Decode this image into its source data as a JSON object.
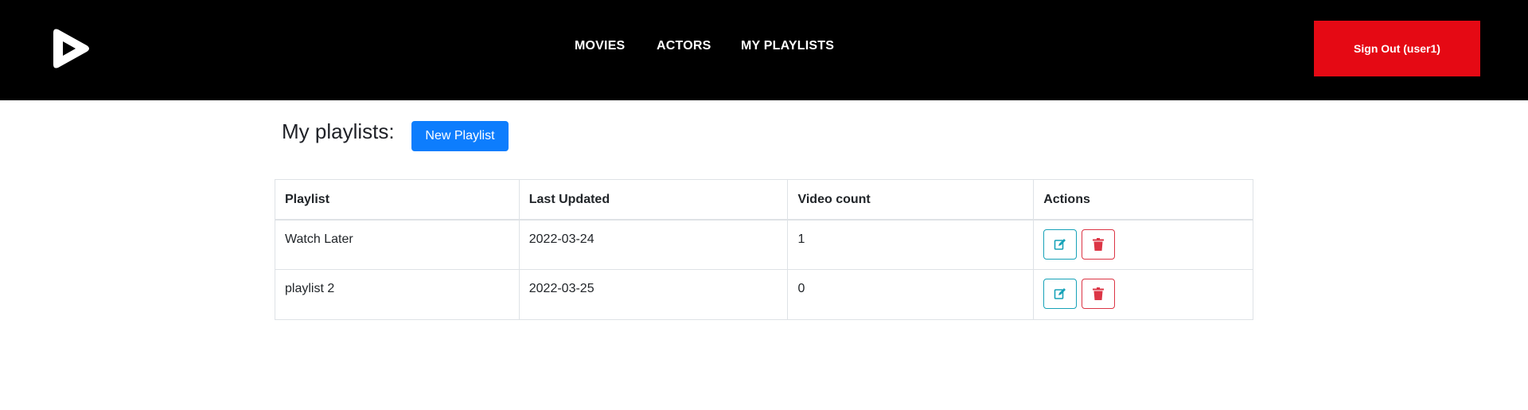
{
  "navbar": {
    "logo_icon": "play-logo-icon",
    "links": {
      "movies": "MOVIES",
      "actors": "ACTORS",
      "playlists": "MY PLAYLISTS"
    },
    "sign_out": "Sign Out (user1)",
    "colors": {
      "background": "#000000",
      "sign_out": "#e50914"
    }
  },
  "main": {
    "heading": "My playlists:",
    "new_button": "New Playlist",
    "table": {
      "headers": [
        "Playlist",
        "Last Updated",
        "Video count",
        "Actions"
      ],
      "rows": [
        {
          "name": "Watch Later",
          "updated": "2022-03-24",
          "count": "1"
        },
        {
          "name": "playlist 2",
          "updated": "2022-03-25",
          "count": "0"
        }
      ],
      "action_icons": {
        "edit": "edit-icon",
        "delete": "trash-icon"
      }
    },
    "colors": {
      "primary": "#0d7dfd",
      "edit": "#17a2b8",
      "delete": "#dc3545"
    }
  }
}
